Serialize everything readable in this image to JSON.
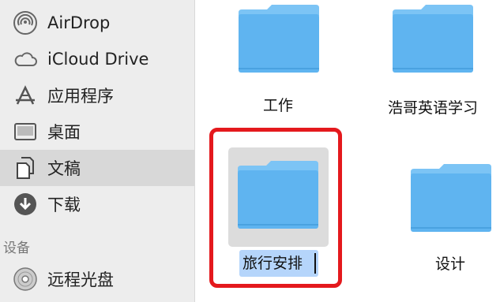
{
  "sidebar": {
    "items": [
      {
        "label": "AirDrop",
        "icon": "airdrop-icon"
      },
      {
        "label": "iCloud Drive",
        "icon": "icloud-icon"
      },
      {
        "label": "应用程序",
        "icon": "applications-icon"
      },
      {
        "label": "桌面",
        "icon": "desktop-icon"
      },
      {
        "label": "文稿",
        "icon": "documents-icon",
        "selected": true
      },
      {
        "label": "下载",
        "icon": "downloads-icon"
      }
    ],
    "devices_header": "设备",
    "devices": [
      {
        "label": "远程光盘",
        "icon": "remote-disc-icon"
      }
    ]
  },
  "files": [
    {
      "name": "工作"
    },
    {
      "name": "浩哥英语学习"
    },
    {
      "name": "旅行安排",
      "selected": true,
      "renaming": true
    },
    {
      "name": "设计"
    }
  ],
  "colors": {
    "folder": "#5fb4f0",
    "folder_top": "#7cc4f5",
    "highlight_box": "#e4191d",
    "rename_selection": "#b5d5fb",
    "sidebar_bg": "#ededed",
    "sidebar_selected": "#d8d8d8"
  }
}
